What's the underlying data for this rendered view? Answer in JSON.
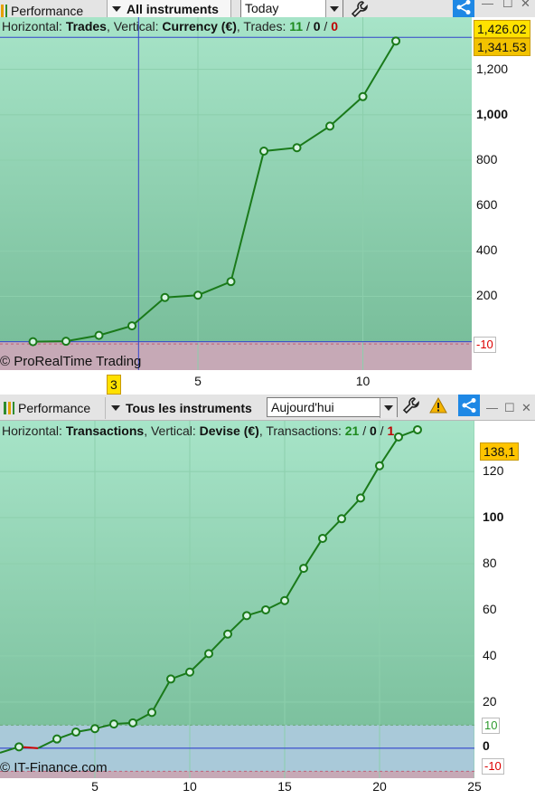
{
  "panel1": {
    "toolbar": {
      "title": "Performance",
      "instrument_label": "All instruments",
      "period_value": "Today"
    },
    "info": {
      "prefix_h": "Horizontal: ",
      "h_value": "Trades",
      "prefix_v": ", Vertical: ",
      "v_value": "Currency (€)",
      "prefix_t": ", Trades: ",
      "wins": "11",
      "sep1": " / ",
      "neutral": "0",
      "sep2": " / ",
      "losses": "0"
    },
    "copyright": "© ProRealTime Trading",
    "badge_top": "1,426.02",
    "badge_cursor": "1,341.53",
    "badge_neg": "-10",
    "x_cursor_label": "3",
    "colors": {
      "line": "#1a7a1a",
      "bg_top": "#a7e4c8",
      "bg_bottom": "#75bb97",
      "neg_zone": "#c6a9b6"
    },
    "chart_data": {
      "type": "line",
      "x": [
        0,
        1,
        2,
        3,
        4,
        5,
        6,
        7,
        8,
        9,
        10,
        11
      ],
      "y": [
        0,
        2,
        28,
        70,
        195,
        205,
        265,
        840,
        855,
        950,
        1080,
        1325
      ],
      "xlim": [
        -1,
        13.3
      ],
      "ylim": [
        -125,
        1430
      ],
      "x_ticks": [
        "5",
        "10"
      ],
      "y_ticks": [
        "200",
        "400",
        "600",
        "800",
        "1,000",
        "1,200"
      ],
      "grid": true
    }
  },
  "panel2": {
    "toolbar": {
      "title": "Performance",
      "instrument_label": "Tous les instruments",
      "period_value": "Aujourd'hui"
    },
    "info": {
      "prefix_h": "Horizontal: ",
      "h_value": "Transactions",
      "prefix_v": ", Vertical: ",
      "v_value": "Devise (€)",
      "prefix_t": ", Transactions: ",
      "wins": "21",
      "sep1": " / ",
      "neutral": "0",
      "sep2": " / ",
      "losses": "1"
    },
    "copyright": "© IT-Finance.com",
    "badge_top": "138,1",
    "badge_pos": "10",
    "badge_zero": "0",
    "badge_neg": "-10",
    "colors": {
      "line": "#1a7a1a",
      "loss_line": "#cc0000",
      "bg_top": "#a7e4c8",
      "bg_bottom": "#75bb97",
      "band": "#a9c9d9"
    },
    "chart_data": {
      "type": "line",
      "x": [
        0,
        1,
        2,
        3,
        4,
        5,
        6,
        7,
        8,
        9,
        10,
        11,
        12,
        13,
        14,
        15,
        16,
        17,
        18,
        19,
        20,
        21,
        22
      ],
      "y": [
        -2,
        0.6,
        0.0,
        4,
        7,
        8.5,
        10.5,
        11,
        15.5,
        30,
        33,
        41,
        49.5,
        57.5,
        60,
        64,
        78,
        91,
        99.5,
        108.5,
        122.5,
        135,
        138.1
      ],
      "xlim": [
        0,
        25
      ],
      "ylim": [
        -13,
        142
      ],
      "x_ticks": [
        "5",
        "10",
        "15",
        "20",
        "25"
      ],
      "y_ticks": [
        "20",
        "40",
        "60",
        "80",
        "100",
        "120"
      ],
      "grid": true
    }
  }
}
